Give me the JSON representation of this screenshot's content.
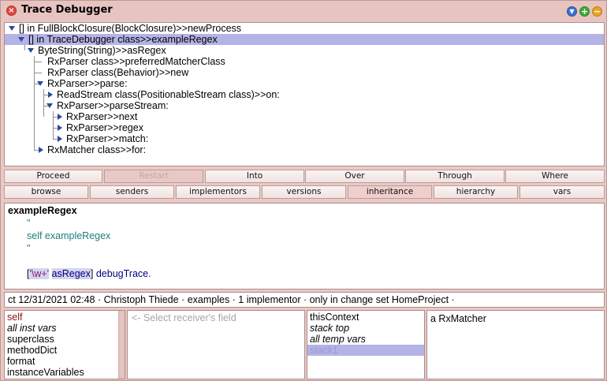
{
  "window": {
    "title": "Trace Debugger",
    "close_glyph": "×",
    "menu_glyph": "▼",
    "max_glyph": "+",
    "min_glyph": "−",
    "icons": [
      "close-icon",
      "window-menu-icon",
      "expand-icon",
      "collapse-icon"
    ],
    "colors": {
      "background": "#ecc8c5",
      "selection": "#b3b3e6",
      "close": "#e2463f",
      "menu": "#3f6fd0",
      "maximize": "#3dac37",
      "minimize": "#e7a426"
    }
  },
  "trace_tree": [
    {
      "label": "[] in FullBlockClosure(BlockClosure)>>newProcess",
      "expanded": true,
      "selected": false
    },
    {
      "label": "[] in TraceDebugger class>>exampleRegex",
      "expanded": true,
      "selected": true
    },
    {
      "label": "ByteString(String)>>asRegex",
      "expanded": true,
      "selected": false
    },
    {
      "label": "RxParser class>>preferredMatcherClass",
      "expanded": null,
      "selected": false
    },
    {
      "label": "RxParser class(Behavior)>>new",
      "expanded": null,
      "selected": false
    },
    {
      "label": "RxParser>>parse:",
      "expanded": true,
      "selected": false
    },
    {
      "label": "ReadStream class(PositionableStream class)>>on:",
      "expanded": false,
      "selected": false
    },
    {
      "label": "RxParser>>parseStream:",
      "expanded": true,
      "selected": false
    },
    {
      "label": "RxParser>>next",
      "expanded": false,
      "selected": false
    },
    {
      "label": "RxParser>>regex",
      "expanded": false,
      "selected": false
    },
    {
      "label": "RxParser>>match:",
      "expanded": false,
      "selected": false
    },
    {
      "label": "RxMatcher class>>for:",
      "expanded": false,
      "selected": false
    }
  ],
  "debug_buttons": [
    "Proceed",
    "Restart",
    "Into",
    "Over",
    "Through",
    "Where"
  ],
  "browse_buttons": [
    "browse",
    "senders",
    "implementors",
    "versions",
    "inheritance",
    "hierarchy",
    "vars"
  ],
  "code": {
    "method_name": "exampleRegex",
    "quote_open": "\"",
    "comment": "self exampleRegex",
    "quote_close": "\"",
    "bracket_open": "[",
    "string_literal": "'\\w+'",
    "message": "asRegex",
    "bracket_close": "]",
    "trailing": "debugTrace."
  },
  "status_line": "ct 12/31/2021 02:48 · Christoph Thiede · examples · 1 implementor · only in change set HomeProject  ·",
  "receiver_vars": [
    {
      "label": "self",
      "italic": false,
      "color": "#8b1010"
    },
    {
      "label": "all inst vars",
      "italic": true
    },
    {
      "label": "superclass",
      "italic": false
    },
    {
      "label": "methodDict",
      "italic": false
    },
    {
      "label": "format",
      "italic": false
    },
    {
      "label": "instanceVariables",
      "italic": false
    }
  ],
  "field_placeholder": "<- Select receiver's field",
  "context_vars": [
    {
      "label": "thisContext",
      "italic": false
    },
    {
      "label": "stack top",
      "italic": true
    },
    {
      "label": "all temp vars",
      "italic": true
    },
    {
      "label": "stack1",
      "italic": false,
      "selected": true
    }
  ],
  "value_text": "a RxMatcher"
}
